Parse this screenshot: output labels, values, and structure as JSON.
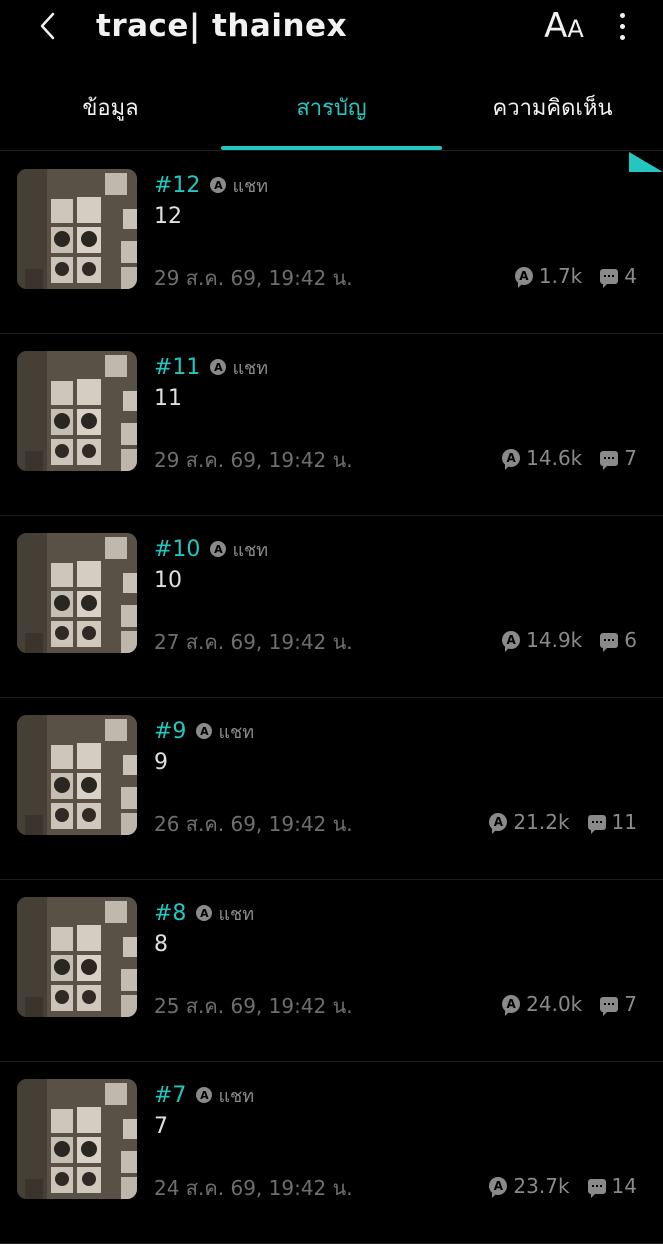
{
  "header": {
    "title": "trace| thainex",
    "font_size_label_big": "A",
    "font_size_label_small": "A",
    "back_icon": "chevron-left-icon",
    "more_icon": "more-vertical-icon"
  },
  "tabs": [
    {
      "label": "ข้อมูล",
      "active": false
    },
    {
      "label": "สารบัญ",
      "active": true
    },
    {
      "label": "ความคิดเห็น",
      "active": false
    }
  ],
  "colors": {
    "accent": "#24c6c0",
    "background": "#000000",
    "muted": "#8a8a8a"
  },
  "chapters": [
    {
      "number": "#12",
      "badge": "A",
      "type": "แชท",
      "title": "12",
      "date": "29 ส.ค. 69, 19:42 น.",
      "views": "1.7k",
      "comments": "4"
    },
    {
      "number": "#11",
      "badge": "A",
      "type": "แชท",
      "title": "11",
      "date": "29 ส.ค. 69, 19:42 น.",
      "views": "14.6k",
      "comments": "7"
    },
    {
      "number": "#10",
      "badge": "A",
      "type": "แชท",
      "title": "10",
      "date": "27 ส.ค. 69, 19:42 น.",
      "views": "14.9k",
      "comments": "6"
    },
    {
      "number": "#9",
      "badge": "A",
      "type": "แชท",
      "title": "9",
      "date": "26 ส.ค. 69, 19:42 น.",
      "views": "21.2k",
      "comments": "11"
    },
    {
      "number": "#8",
      "badge": "A",
      "type": "แชท",
      "title": "8",
      "date": "25 ส.ค. 69, 19:42 น.",
      "views": "24.0k",
      "comments": "7"
    },
    {
      "number": "#7",
      "badge": "A",
      "type": "แชท",
      "title": "7",
      "date": "24 ส.ค. 69, 19:42 น.",
      "views": "23.7k",
      "comments": "14"
    }
  ]
}
